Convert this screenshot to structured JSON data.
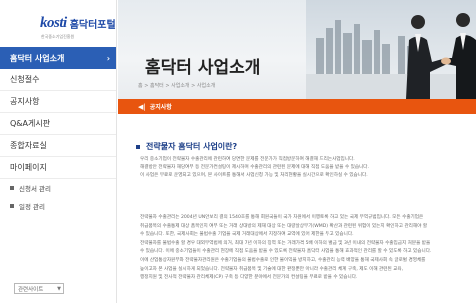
{
  "logo": {
    "brand": "kosti",
    "name": "홈닥터포털",
    "sub": "한국중소기업진흥원"
  },
  "sidebar": {
    "items": [
      {
        "label": "홈닥터 사업소개",
        "active": true
      },
      {
        "label": "신청절수"
      },
      {
        "label": "공지사항"
      },
      {
        "label": "Q&A게시판"
      },
      {
        "label": "종합자료실"
      },
      {
        "label": "마이페이지"
      }
    ],
    "sub_items": [
      {
        "label": "신청서 관리"
      },
      {
        "label": "일정 관리"
      }
    ],
    "site_select": "관련사이트"
  },
  "banner": {
    "title": "홈닥터 사업소개",
    "breadcrumb": "홈 > 홈닥터 > 사업소개 > 사업소개"
  },
  "notice": {
    "label": "공지사항"
  },
  "section": {
    "title": "전략물자 홈닥터 사업이란?"
  },
  "intro_lines": [
    "우리 중소기업이 전략물자 수출관리에 관련하여 당면한 문제를 전문가가 직접방문하여 해결해 드리는사업입니다.",
    "해결방안 전략물자 해당여부 등 전문가컨설팅이 제시하며 수출관리의 관련된 문제에 대해 직접 도움을 받을 수 있습니다.",
    "이 사업은 무료로 운영되고 있으며, 본 사이트를 통해서 사업신청 가능 및 처리현황을 실시간으로 확인하실 수 있습니다."
  ],
  "body_lines": [
    "전략물자 수출관리는 2004년 UN안보리 결의 1540호를 통해 회원국들이 국가 차원에서 이행토록 하고 있는 국제 무역규범입니다. 모든 수출기업은",
    "취급품목의 수출통제 대상 품목인지 여부 또는 거래 상대방의 제재 대상 또는 대량살상무기(WMD) 확산과 관련된 위험이 있는지 확인하고 관리해야 할",
    "수 있습니다. 또한, 국제사회는 불법수출 기업을 국제 거래대상에서 지정하여 교역에 있어 제한을 두고 있습니다.",
    "전략물자를 불법수출 할 경우 대외무역법에 의거, 최대 7년 이하의 징역 또는 거래가격 5배 이하의 벌금 및 3년 이내의 전략물자 수출입금지 처분을 받을",
    "수 있습니다. 이에 중소기업들이 수출관리 현장에 직접 도움을 받을 수 있도록 전략물자 홈닥터 사업을 통해 효과적인 관리를 할 수 있도록 하고 있습니다.",
    "이에 산업통상자원부와 전략물자관리원은 수출기업들의 불법수출로 인한 불이익을 방지하고, 수출관리 능력 배양을 통해 국제사회 속 글로벌 경영체를",
    "높이고자 본 사업을 실시하게 되었습니다. 전략물자 취급품목 및 기술에 대한 판정뿐만 아니라 수출관리 체계 구축, 제도 이해 관련된 교육,",
    "행정지원 및 전사적 전략물자 관리체제(CP) 구축 등 다양한 분야에서 전문가의 컨설팅을 무료로 받을 수 있습니다."
  ],
  "colors": {
    "accent": "#2b5fb5",
    "notice": "#e8550f",
    "title_blue": "#1d3f88"
  }
}
